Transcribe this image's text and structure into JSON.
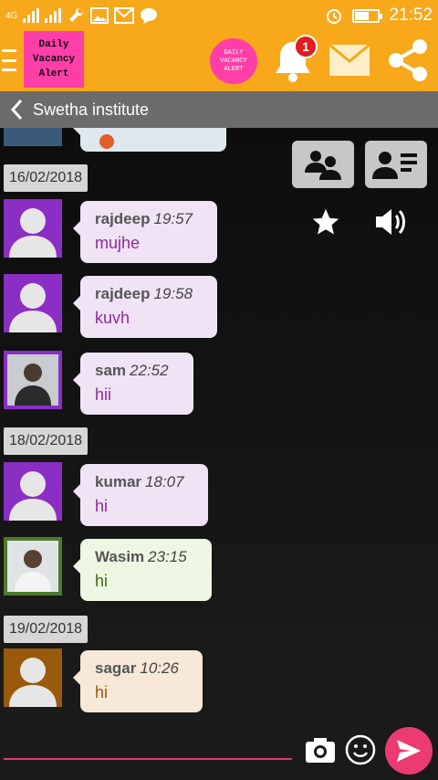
{
  "status_bar": {
    "network": "4G",
    "time": "21:52",
    "battery_level": 0.55
  },
  "header": {
    "logo_text": "Daily Vacancy Alert",
    "round_logo_text": "DAILY VACANCY ALERT",
    "notification_count": "1",
    "brand_color": "#f7a81b",
    "accent_color": "#ff3ea8"
  },
  "subheader": {
    "title": "Swetha institute"
  },
  "chat": {
    "groups": [
      {
        "date": "16/02/2018",
        "messages": [
          {
            "name": "rajdeep",
            "time": "19:57",
            "text": "mujhe",
            "avatar": "default-avatar",
            "bubble": "purple"
          },
          {
            "name": "rajdeep",
            "time": "19:58",
            "text": "kuvh",
            "avatar": "default-avatar",
            "bubble": "purple"
          },
          {
            "name": "sam",
            "time": "22:52",
            "text": "hii",
            "avatar": "photo-avatar",
            "bubble": "purple"
          }
        ]
      },
      {
        "date": "18/02/2018",
        "messages": [
          {
            "name": "kumar",
            "time": "18:07",
            "text": "hi",
            "avatar": "default-avatar",
            "bubble": "purple"
          },
          {
            "name": "Wasim",
            "time": "23:15",
            "text": "hi",
            "avatar": "photo-avatar",
            "bubble": "green"
          }
        ]
      },
      {
        "date": "19/02/2018",
        "messages": [
          {
            "name": "sagar",
            "time": "10:26",
            "text": "hi",
            "avatar": "default-avatar-brown",
            "bubble": "peach"
          }
        ]
      }
    ]
  },
  "input": {
    "placeholder": "",
    "value": ""
  },
  "icons": {
    "menu": "hamburger-icon",
    "bell": "bell-icon",
    "mail": "mail-icon",
    "share": "share-icon",
    "back": "chevron-left-icon",
    "group": "group-icon",
    "contact": "contact-card-icon",
    "star": "star-icon",
    "speaker": "speaker-icon",
    "camera": "camera-icon",
    "emoji": "emoji-icon",
    "send": "send-icon"
  }
}
